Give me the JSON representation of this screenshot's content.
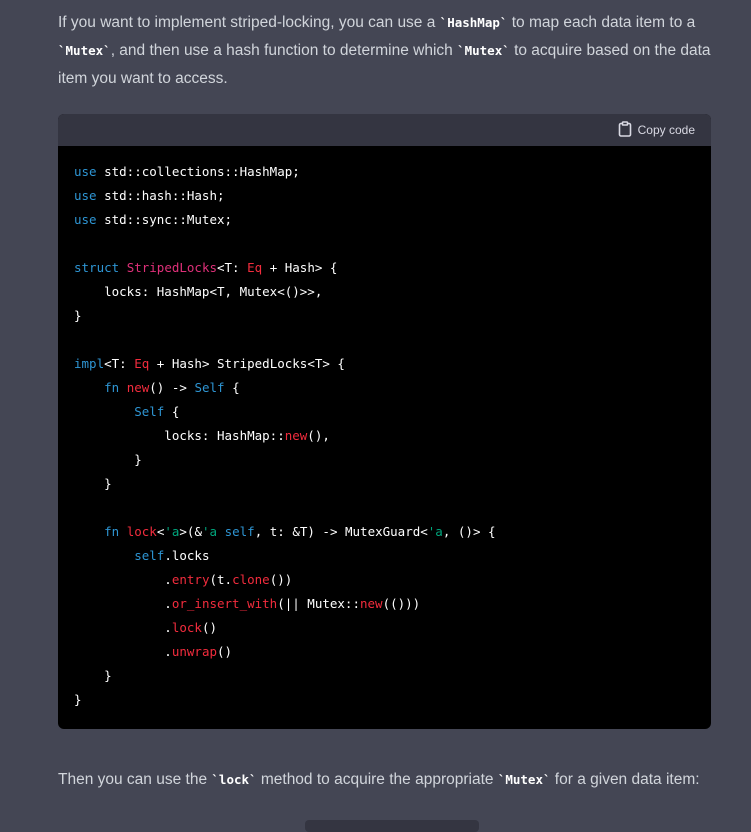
{
  "intro": {
    "t1": "If you want to implement striped-locking, you can use a ",
    "c1": "`HashMap`",
    "t2": " to map each data item to a ",
    "c2": "`Mutex`",
    "t3": ", and then use a hash function to determine which ",
    "c3": "`Mutex`",
    "t4": " to acquire based on the data item you want to access."
  },
  "code": {
    "copy_label": "Copy code",
    "lines": [
      [
        [
          "k",
          "use"
        ],
        [
          "p",
          " std::collections::HashMap;"
        ]
      ],
      [
        [
          "k",
          "use"
        ],
        [
          "p",
          " std::hash::Hash;"
        ]
      ],
      [
        [
          "k",
          "use"
        ],
        [
          "p",
          " std::sync::Mutex;"
        ]
      ],
      [],
      [
        [
          "k",
          "struct"
        ],
        [
          "p",
          " "
        ],
        [
          "t",
          "StripedLocks"
        ],
        [
          "p",
          "<T: "
        ],
        [
          "o",
          "Eq"
        ],
        [
          "p",
          " + Hash> {"
        ]
      ],
      [
        [
          "p",
          "    locks: HashMap<T, Mutex<()>>,"
        ]
      ],
      [
        [
          "p",
          "}"
        ]
      ],
      [],
      [
        [
          "k",
          "impl"
        ],
        [
          "p",
          "<T: "
        ],
        [
          "o",
          "Eq"
        ],
        [
          "p",
          " + Hash> StripedLocks<T> {"
        ]
      ],
      [
        [
          "p",
          "    "
        ],
        [
          "k",
          "fn"
        ],
        [
          "p",
          " "
        ],
        [
          "o",
          "new"
        ],
        [
          "p",
          "() -> "
        ],
        [
          "k",
          "Self"
        ],
        [
          "p",
          " {"
        ]
      ],
      [
        [
          "p",
          "        "
        ],
        [
          "k",
          "Self"
        ],
        [
          "p",
          " {"
        ]
      ],
      [
        [
          "p",
          "            locks: HashMap::"
        ],
        [
          "o",
          "new"
        ],
        [
          "p",
          "(),"
        ]
      ],
      [
        [
          "p",
          "        }"
        ]
      ],
      [
        [
          "p",
          "    }"
        ]
      ],
      [],
      [
        [
          "p",
          "    "
        ],
        [
          "k",
          "fn"
        ],
        [
          "p",
          " "
        ],
        [
          "o",
          "lock"
        ],
        [
          "p",
          "<"
        ],
        [
          "s",
          "'a"
        ],
        [
          "p",
          ">(&"
        ],
        [
          "s",
          "'a"
        ],
        [
          "p",
          " "
        ],
        [
          "k",
          "self"
        ],
        [
          "p",
          ", t: &T) -> MutexGuard<"
        ],
        [
          "s",
          "'a"
        ],
        [
          "p",
          ", ()> {"
        ]
      ],
      [
        [
          "p",
          "        "
        ],
        [
          "k",
          "self"
        ],
        [
          "p",
          ".locks"
        ]
      ],
      [
        [
          "p",
          "            ."
        ],
        [
          "o",
          "entry"
        ],
        [
          "p",
          "(t."
        ],
        [
          "o",
          "clone"
        ],
        [
          "p",
          "())"
        ]
      ],
      [
        [
          "p",
          "            ."
        ],
        [
          "o",
          "or_insert_with"
        ],
        [
          "p",
          "(|| Mutex::"
        ],
        [
          "o",
          "new"
        ],
        [
          "p",
          "(()))"
        ]
      ],
      [
        [
          "p",
          "            ."
        ],
        [
          "o",
          "lock"
        ],
        [
          "p",
          "()"
        ]
      ],
      [
        [
          "p",
          "            ."
        ],
        [
          "o",
          "unwrap"
        ],
        [
          "p",
          "()"
        ]
      ],
      [
        [
          "p",
          "    }"
        ]
      ],
      [
        [
          "p",
          "}"
        ]
      ]
    ]
  },
  "outro": {
    "t1": "Then you can use the ",
    "c1": "`lock`",
    "t2": " method to acquire the appropriate ",
    "c2": "`Mutex`",
    "t3": " for a given data item:"
  }
}
